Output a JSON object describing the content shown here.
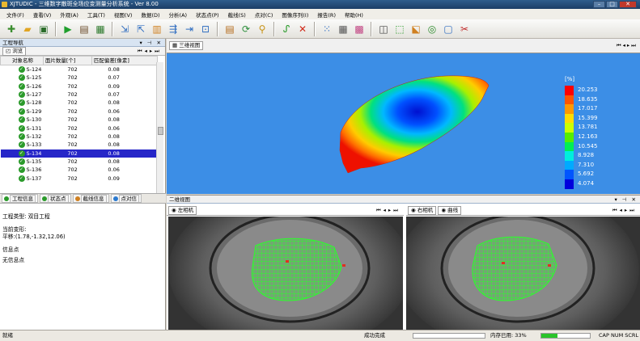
{
  "window": {
    "title": "XJTUDIC - 三维数字散斑全场应变测量分析系统 - Ver 8.00"
  },
  "menu": [
    "文件(F)",
    "查看(V)",
    "外观(A)",
    "工具(T)",
    "视图(V)",
    "数据(D)",
    "分析(A)",
    "状态点(P)",
    "截线(S)",
    "点对(C)",
    "图像序列(I)",
    "报告(R)",
    "帮助(H)"
  ],
  "toolbar": [
    "new-icon",
    "open-icon",
    "save-icon",
    "run-icon",
    "calculate-icon",
    "display-icon",
    "import-icon",
    "export-icon",
    "stage-icon",
    "sequence-icon",
    "point-icon",
    "fit-icon",
    "report-icon",
    "refresh-icon",
    "search-icon",
    "curve-icon",
    "delete-icon",
    "grid-icon",
    "table-icon",
    "color-map-icon",
    "cube-icon",
    "vector-icon",
    "strain-icon",
    "target-icon",
    "clipboard-icon",
    "cut-icon"
  ],
  "left_panel": {
    "title": "工程导航",
    "subtab": "浏览",
    "columns": [
      "对象名称",
      "面片数量[个]",
      "匹配偏差[像素]"
    ],
    "rows": [
      {
        "name": "S-124",
        "count": "702",
        "dev": "0.08"
      },
      {
        "name": "S-125",
        "count": "702",
        "dev": "0.07"
      },
      {
        "name": "S-126",
        "count": "702",
        "dev": "0.09"
      },
      {
        "name": "S-127",
        "count": "702",
        "dev": "0.07"
      },
      {
        "name": "S-128",
        "count": "702",
        "dev": "0.08"
      },
      {
        "name": "S-129",
        "count": "702",
        "dev": "0.06"
      },
      {
        "name": "S-130",
        "count": "702",
        "dev": "0.08"
      },
      {
        "name": "S-131",
        "count": "702",
        "dev": "0.06"
      },
      {
        "name": "S-132",
        "count": "702",
        "dev": "0.08"
      },
      {
        "name": "S-133",
        "count": "702",
        "dev": "0.08"
      },
      {
        "name": "S-134",
        "count": "702",
        "dev": "0.08"
      },
      {
        "name": "S-135",
        "count": "702",
        "dev": "0.08"
      },
      {
        "name": "S-136",
        "count": "702",
        "dev": "0.06"
      },
      {
        "name": "S-137",
        "count": "702",
        "dev": "0.09"
      }
    ],
    "selected_row": "S-134",
    "info_tabs": [
      "工程信息",
      "状态点",
      "截线信息",
      "点对信"
    ],
    "info": {
      "type": "工程类型: 双目工程",
      "current_label": "当前变形:",
      "translation": "平移:(1.78,-1.32,12.06)",
      "info_point": "信息点",
      "no_info_point": "无信息点"
    }
  },
  "view3d": {
    "tab": "三维视图"
  },
  "legend": {
    "unit": "[%]",
    "values": [
      "20.253",
      "18.635",
      "17.017",
      "15.399",
      "13.781",
      "12.163",
      "10.545",
      "8.928",
      "7.310",
      "5.692",
      "4.074"
    ],
    "colors": [
      "#ff0000",
      "#ff5500",
      "#ff9900",
      "#ffdd00",
      "#ccff00",
      "#55ee00",
      "#00ee55",
      "#00eedd",
      "#00aaff",
      "#0055ff",
      "#0000dd"
    ]
  },
  "bottom": {
    "title": "二维视图",
    "left_tab": "左相机",
    "right_tabs": [
      "右相机",
      "曲线"
    ]
  },
  "status": {
    "ready": "就绪",
    "done": "成功完成",
    "memory": "内存已用: 33%",
    "caps": "CAP NUM SCRL"
  }
}
